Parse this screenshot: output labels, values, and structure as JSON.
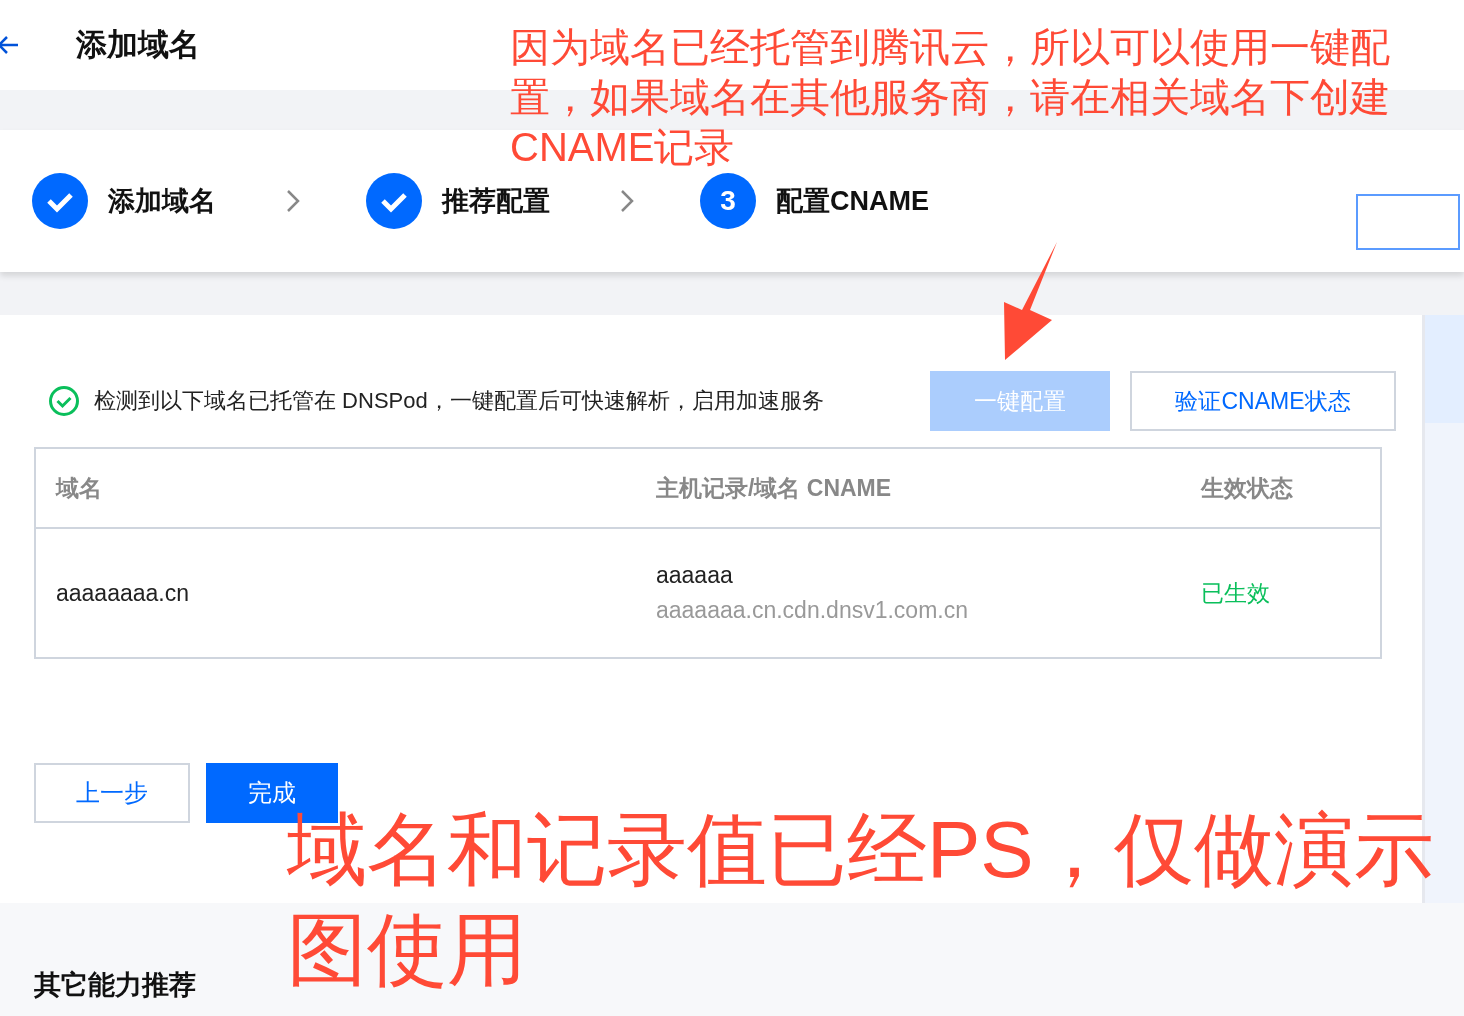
{
  "header": {
    "title": "添加域名"
  },
  "steps": [
    {
      "label": "添加域名",
      "done": true
    },
    {
      "label": "推荐配置",
      "done": true
    },
    {
      "label": "配置CNAME",
      "done": false,
      "number": "3"
    }
  ],
  "notice": {
    "text": "检测到以下域名已托管在 DNSPod，一键配置后可快速解析，启用加速服务"
  },
  "actions": [
    {
      "label": "一键配置",
      "kind": "primary",
      "disabled": true
    },
    {
      "label": "验证CNAME状态",
      "kind": "secondary",
      "disabled": false
    }
  ],
  "table": {
    "columns": [
      "域名",
      "主机记录/域名 CNAME",
      "生效状态"
    ],
    "rows": [
      {
        "domain": "aaaaaaaa.cn",
        "host": "aaaaaa",
        "cname": "aaaaaaa.cn.cdn.dnsv1.com.cn",
        "status": "已生效",
        "color": "#0abf5b"
      }
    ]
  },
  "footer_buttons": [
    {
      "label": "上一步",
      "kind": "secondary"
    },
    {
      "label": "完成",
      "kind": "primary"
    }
  ],
  "recommend": {
    "title": "其它能力推荐"
  },
  "annotations": [
    {
      "text": "因为域名已经托管到腾讯云，所以可以使用一键配置，如果域名在其他服务商，请在相关域名下创建CNAME记录",
      "kind": "small"
    },
    {
      "text": "域名和记录值已经PS，仅做演示图使用",
      "kind": "large"
    }
  ]
}
